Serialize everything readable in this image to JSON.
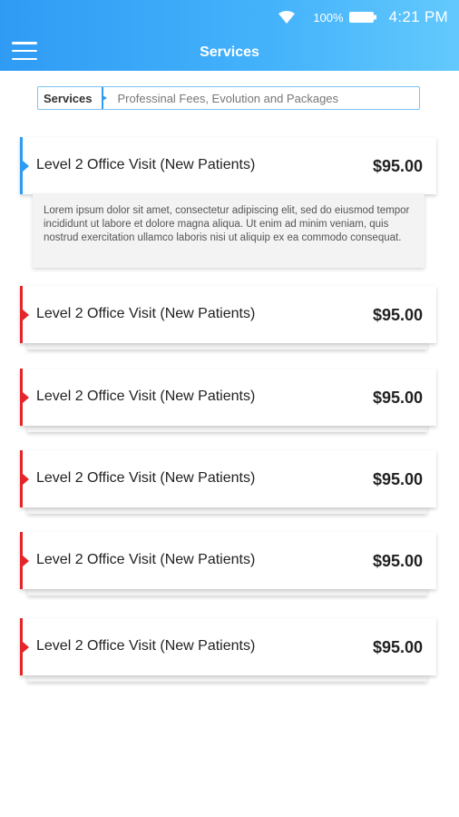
{
  "status_bar": {
    "battery": "100%",
    "time": "4:21 PM"
  },
  "header": {
    "title": "Services"
  },
  "breadcrumb": {
    "primary": "Services",
    "secondary": "Professinal Fees, Evolution and Packages"
  },
  "services": [
    {
      "title": "Level 2 Office Visit (New Patients)",
      "price": "$95.00",
      "expanded": true,
      "description": "Lorem ipsum dolor sit amet, consectetur adipiscing elit, sed do eiusmod tempor incididunt ut labore et dolore magna aliqua. Ut enim ad minim veniam, quis nostrud exercitation ullamco laboris nisi ut aliquip ex ea commodo consequat."
    },
    {
      "title": "Level 2 Office Visit (New Patients)",
      "price": "$95.00"
    },
    {
      "title": "Level 2 Office Visit (New Patients)",
      "price": "$95.00"
    },
    {
      "title": "Level 2 Office Visit (New Patients)",
      "price": "$95.00"
    },
    {
      "title": "Level 2 Office Visit (New Patients)",
      "price": "$95.00"
    },
    {
      "title": "Level 2 Office Visit (New Patients)",
      "price": "$95.00"
    }
  ],
  "colors": {
    "accent": "#2e9cf3",
    "marker": "#e4252b",
    "header_start": "#2f9bf4",
    "header_end": "#63c9fd"
  }
}
